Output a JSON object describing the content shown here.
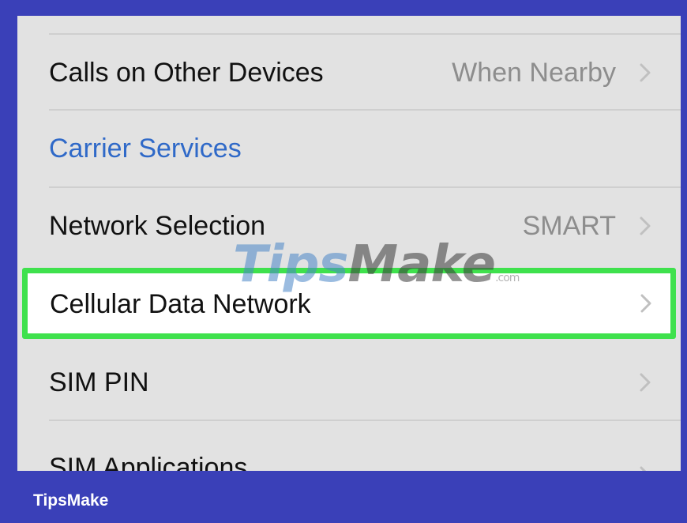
{
  "settings": {
    "rows": [
      {
        "label": "Calls on Other Devices",
        "value": "When Nearby"
      },
      {
        "label": "Carrier Services"
      },
      {
        "label": "Network Selection",
        "value": "SMART"
      },
      {
        "label": "Cellular Data Network"
      },
      {
        "label": "SIM PIN"
      },
      {
        "label": "SIM Applications"
      }
    ]
  },
  "watermark": {
    "part1": "Tips",
    "part2": "Make",
    "suffix": ".com"
  },
  "footer": {
    "brand": "TipsMake"
  },
  "colors": {
    "frame": "#3a40b8",
    "highlight": "#3fe14d",
    "link": "#2f69c8"
  },
  "icons": {
    "chevron": "chevron-right-icon"
  }
}
